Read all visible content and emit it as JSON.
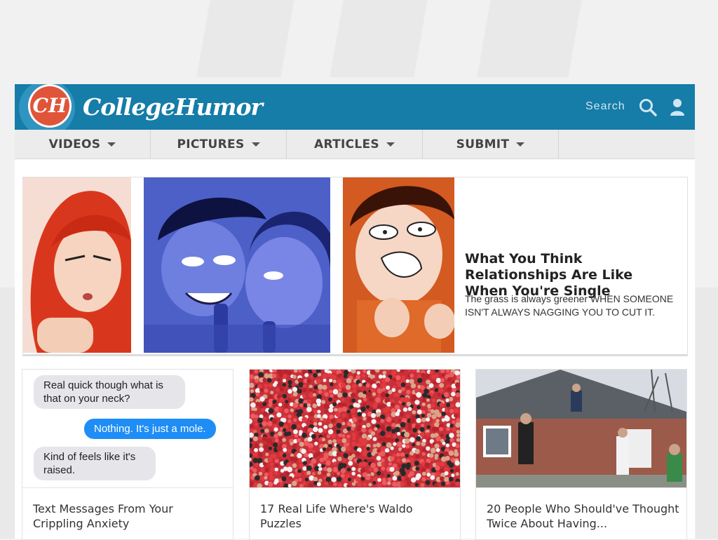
{
  "header": {
    "logo_mark": "CH",
    "logo_text": "CollegeHumor",
    "search_label": "Search",
    "icons": [
      "search-icon",
      "user-icon"
    ],
    "brand_color": "#167ca8"
  },
  "nav": {
    "items": [
      {
        "label": "VIDEOS"
      },
      {
        "label": "PICTURES"
      },
      {
        "label": "ARTICLES"
      },
      {
        "label": "SUBMIT"
      }
    ]
  },
  "hero": {
    "title": "What You Think Relationships Are Like When You're Single",
    "description": "The grass is always greener WHEN SOMEONE ISN'T ALWAYS NAGGING YOU TO CUT IT."
  },
  "cards": [
    {
      "title": "Text Messages From Your Crippling Anxiety",
      "messages": [
        {
          "text": "Real quick though what is that on your neck?",
          "from": "them"
        },
        {
          "text": "Nothing. It's just a mole.",
          "from": "me"
        },
        {
          "text": "Kind of feels like it's raised.",
          "from": "them"
        }
      ]
    },
    {
      "title": "17 Real Life Where's Waldo Puzzles"
    },
    {
      "title": "20 People Who Should've Thought Twice About Having..."
    }
  ]
}
